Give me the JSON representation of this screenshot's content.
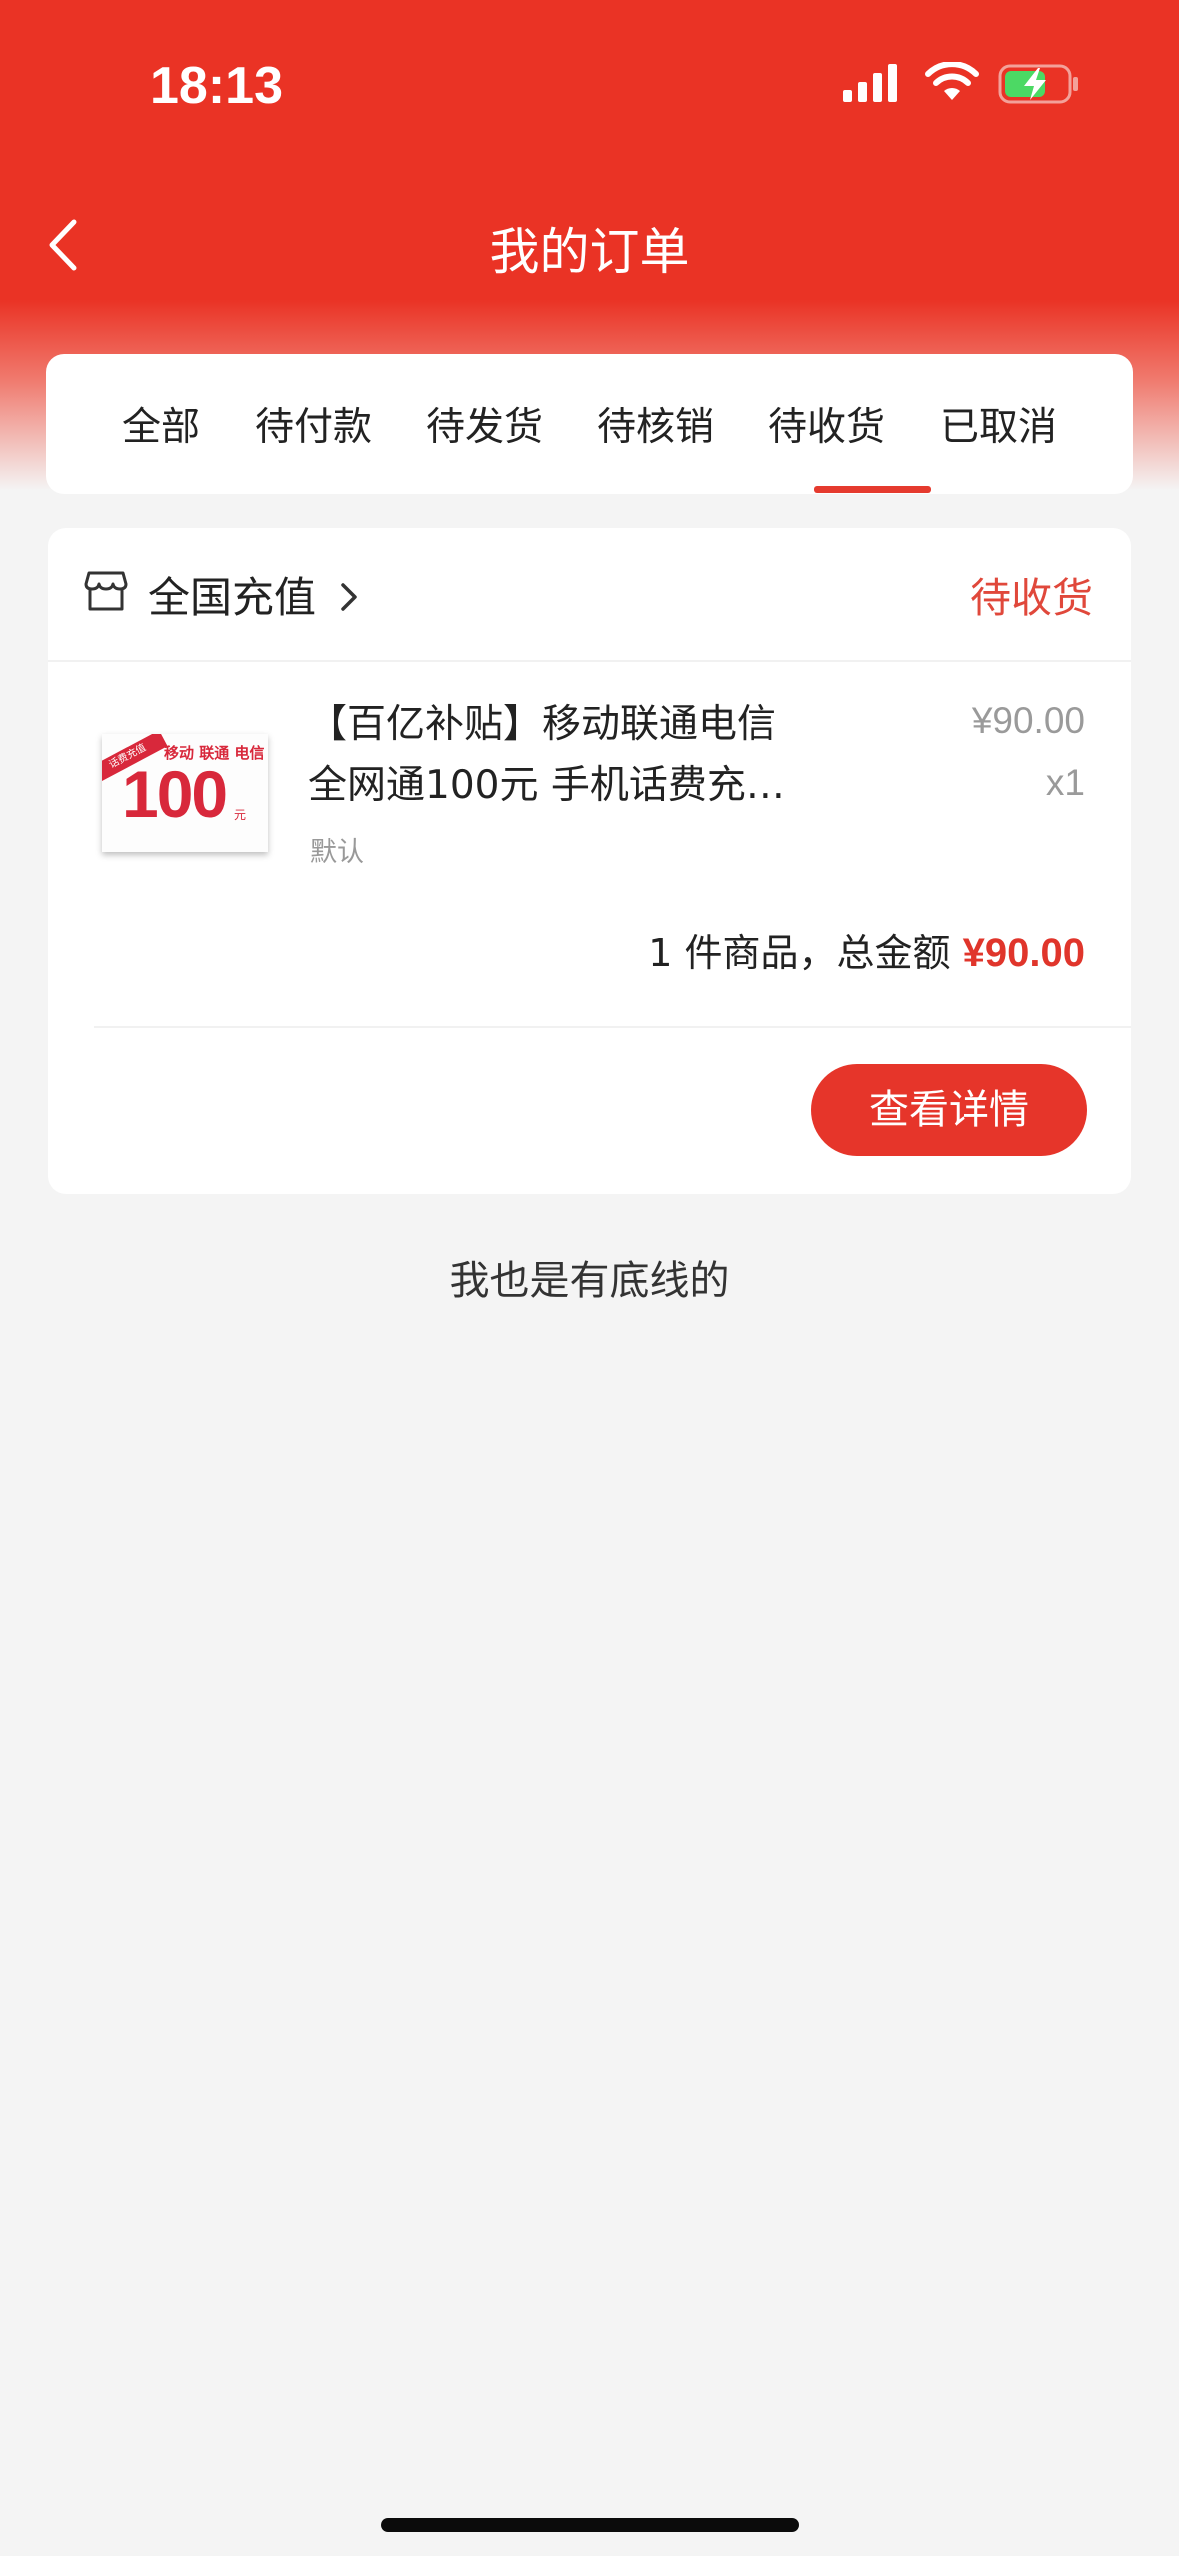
{
  "status_bar": {
    "time": "18:13",
    "icons": [
      "signal-icon",
      "wifi-icon",
      "battery-charging-icon"
    ]
  },
  "nav": {
    "back_icon": "back-arrow-icon",
    "title": "我的订单"
  },
  "tabs": [
    {
      "label": "全部",
      "active": false
    },
    {
      "label": "待付款",
      "active": false
    },
    {
      "label": "待发货",
      "active": false
    },
    {
      "label": "待核销",
      "active": false
    },
    {
      "label": "待收货",
      "active": true
    },
    {
      "label": "已取消",
      "active": false
    }
  ],
  "order": {
    "store_icon": "store-icon",
    "store_name": "全国充值",
    "status": "待收货",
    "product": {
      "thumbnail": {
        "ribbon": "话费充值",
        "carriers": "移动 联通 电信",
        "amount": "100",
        "unit": "元"
      },
      "title_line1": "【百亿补贴】移动联通电信",
      "title_line2": "全网通100元 手机话费充…",
      "spec": "默认",
      "unit_price": "¥90.00",
      "quantity": "x1"
    },
    "summary_label": "1 件商品，总金额",
    "total": "¥90.00",
    "detail_button": "查看详情"
  },
  "footer_note": "我也是有底线的",
  "colors": {
    "brand_red": "#ea3325",
    "price_red": "#e0352b",
    "background": "#f4f4f4"
  }
}
